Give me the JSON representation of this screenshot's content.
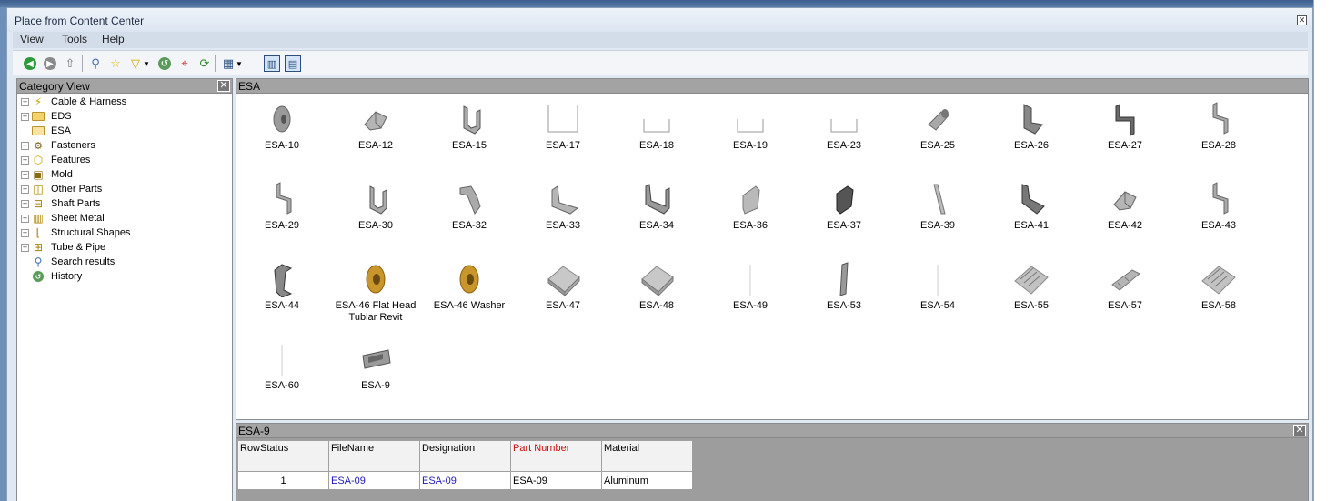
{
  "window": {
    "title": "Place from Content Center"
  },
  "menu": [
    {
      "label": "View"
    },
    {
      "label": "Tools"
    },
    {
      "label": "Help"
    }
  ],
  "toolbar": [
    {
      "icon": "back-icon"
    },
    {
      "icon": "forward-icon"
    },
    {
      "icon": "up-level-icon"
    },
    {
      "icon": "search-icon"
    },
    {
      "icon": "favorites-star-icon"
    },
    {
      "icon": "filter-icon"
    },
    {
      "icon": "filter-dropdown-icon"
    },
    {
      "icon": "history-icon"
    },
    {
      "icon": "member-search-icon"
    },
    {
      "icon": "refresh-icon"
    },
    {
      "icon": "view-mode-icon"
    },
    {
      "icon": "tree-view-toggle-icon"
    },
    {
      "icon": "table-view-toggle-icon"
    }
  ],
  "tree": {
    "header": "Category View",
    "items": [
      {
        "label": "Cable & Harness",
        "icon": "cable-harness-icon",
        "expandable": true
      },
      {
        "label": "EDS",
        "icon": "folder-icon",
        "expandable": true
      },
      {
        "label": "ESA",
        "icon": "folder-icon",
        "expandable": false
      },
      {
        "label": "Fasteners",
        "icon": "fasteners-icon",
        "expandable": true
      },
      {
        "label": "Features",
        "icon": "features-icon",
        "expandable": true
      },
      {
        "label": "Mold",
        "icon": "mold-icon",
        "expandable": true
      },
      {
        "label": "Other Parts",
        "icon": "other-parts-icon",
        "expandable": true
      },
      {
        "label": "Shaft Parts",
        "icon": "shaft-parts-icon",
        "expandable": true
      },
      {
        "label": "Sheet Metal",
        "icon": "sheet-metal-icon",
        "expandable": true
      },
      {
        "label": "Structural Shapes",
        "icon": "structural-shapes-icon",
        "expandable": true
      },
      {
        "label": "Tube & Pipe",
        "icon": "tube-pipe-icon",
        "expandable": true
      },
      {
        "label": "Search results",
        "icon": "search-results-icon",
        "expandable": false
      },
      {
        "label": "History",
        "icon": "history-icon",
        "expandable": false
      }
    ]
  },
  "grid": {
    "header": "ESA",
    "items": [
      {
        "label": "ESA-10",
        "shape": "disc"
      },
      {
        "label": "ESA-12",
        "shape": "bracket"
      },
      {
        "label": "ESA-15",
        "shape": "channel"
      },
      {
        "label": "ESA-17",
        "shape": "outline-u"
      },
      {
        "label": "ESA-18",
        "shape": "outline-u-small"
      },
      {
        "label": "ESA-19",
        "shape": "outline-u-small"
      },
      {
        "label": "ESA-23",
        "shape": "outline-u-small"
      },
      {
        "label": "ESA-25",
        "shape": "cylinder"
      },
      {
        "label": "ESA-26",
        "shape": "angle"
      },
      {
        "label": "ESA-27",
        "shape": "zed"
      },
      {
        "label": "ESA-28",
        "shape": "zed-small"
      },
      {
        "label": "ESA-29",
        "shape": "zed-small"
      },
      {
        "label": "ESA-30",
        "shape": "channel"
      },
      {
        "label": "ESA-32",
        "shape": "hat"
      },
      {
        "label": "ESA-33",
        "shape": "angle-wide"
      },
      {
        "label": "ESA-34",
        "shape": "channel-wide"
      },
      {
        "label": "ESA-36",
        "shape": "plate-tall"
      },
      {
        "label": "ESA-37",
        "shape": "plate-dark"
      },
      {
        "label": "ESA-39",
        "shape": "rod"
      },
      {
        "label": "ESA-41",
        "shape": "angle-dark"
      },
      {
        "label": "ESA-42",
        "shape": "bracket"
      },
      {
        "label": "ESA-43",
        "shape": "zed-small"
      },
      {
        "label": "ESA-44",
        "shape": "channel-dark"
      },
      {
        "label": "ESA-46 Flat Head Tublar Revit",
        "shape": "washer-gold"
      },
      {
        "label": "ESA-46 Washer",
        "shape": "washer-gold"
      },
      {
        "label": "ESA-47",
        "shape": "plate-flat"
      },
      {
        "label": "ESA-48",
        "shape": "plate-flat"
      },
      {
        "label": "ESA-49",
        "shape": "line"
      },
      {
        "label": "ESA-53",
        "shape": "rod-dark"
      },
      {
        "label": "ESA-54",
        "shape": "line"
      },
      {
        "label": "ESA-55",
        "shape": "ribbed"
      },
      {
        "label": "ESA-57",
        "shape": "clip"
      },
      {
        "label": "ESA-58",
        "shape": "ribbed"
      },
      {
        "label": "ESA-60",
        "shape": "line"
      },
      {
        "label": "ESA-9",
        "shape": "tray"
      }
    ]
  },
  "details": {
    "header": "ESA-9",
    "columns": [
      {
        "label": "RowStatus",
        "highlight": false
      },
      {
        "label": "FileName",
        "highlight": false
      },
      {
        "label": "Designation",
        "highlight": false
      },
      {
        "label": "Part Number",
        "highlight": true
      },
      {
        "label": "Material",
        "highlight": false
      }
    ],
    "row": [
      "1",
      "ESA-09",
      "ESA-09",
      "ESA-09",
      "Aluminum"
    ]
  },
  "colors": {
    "accent_link": "#1a1ab0",
    "key_column": "#d01010"
  }
}
